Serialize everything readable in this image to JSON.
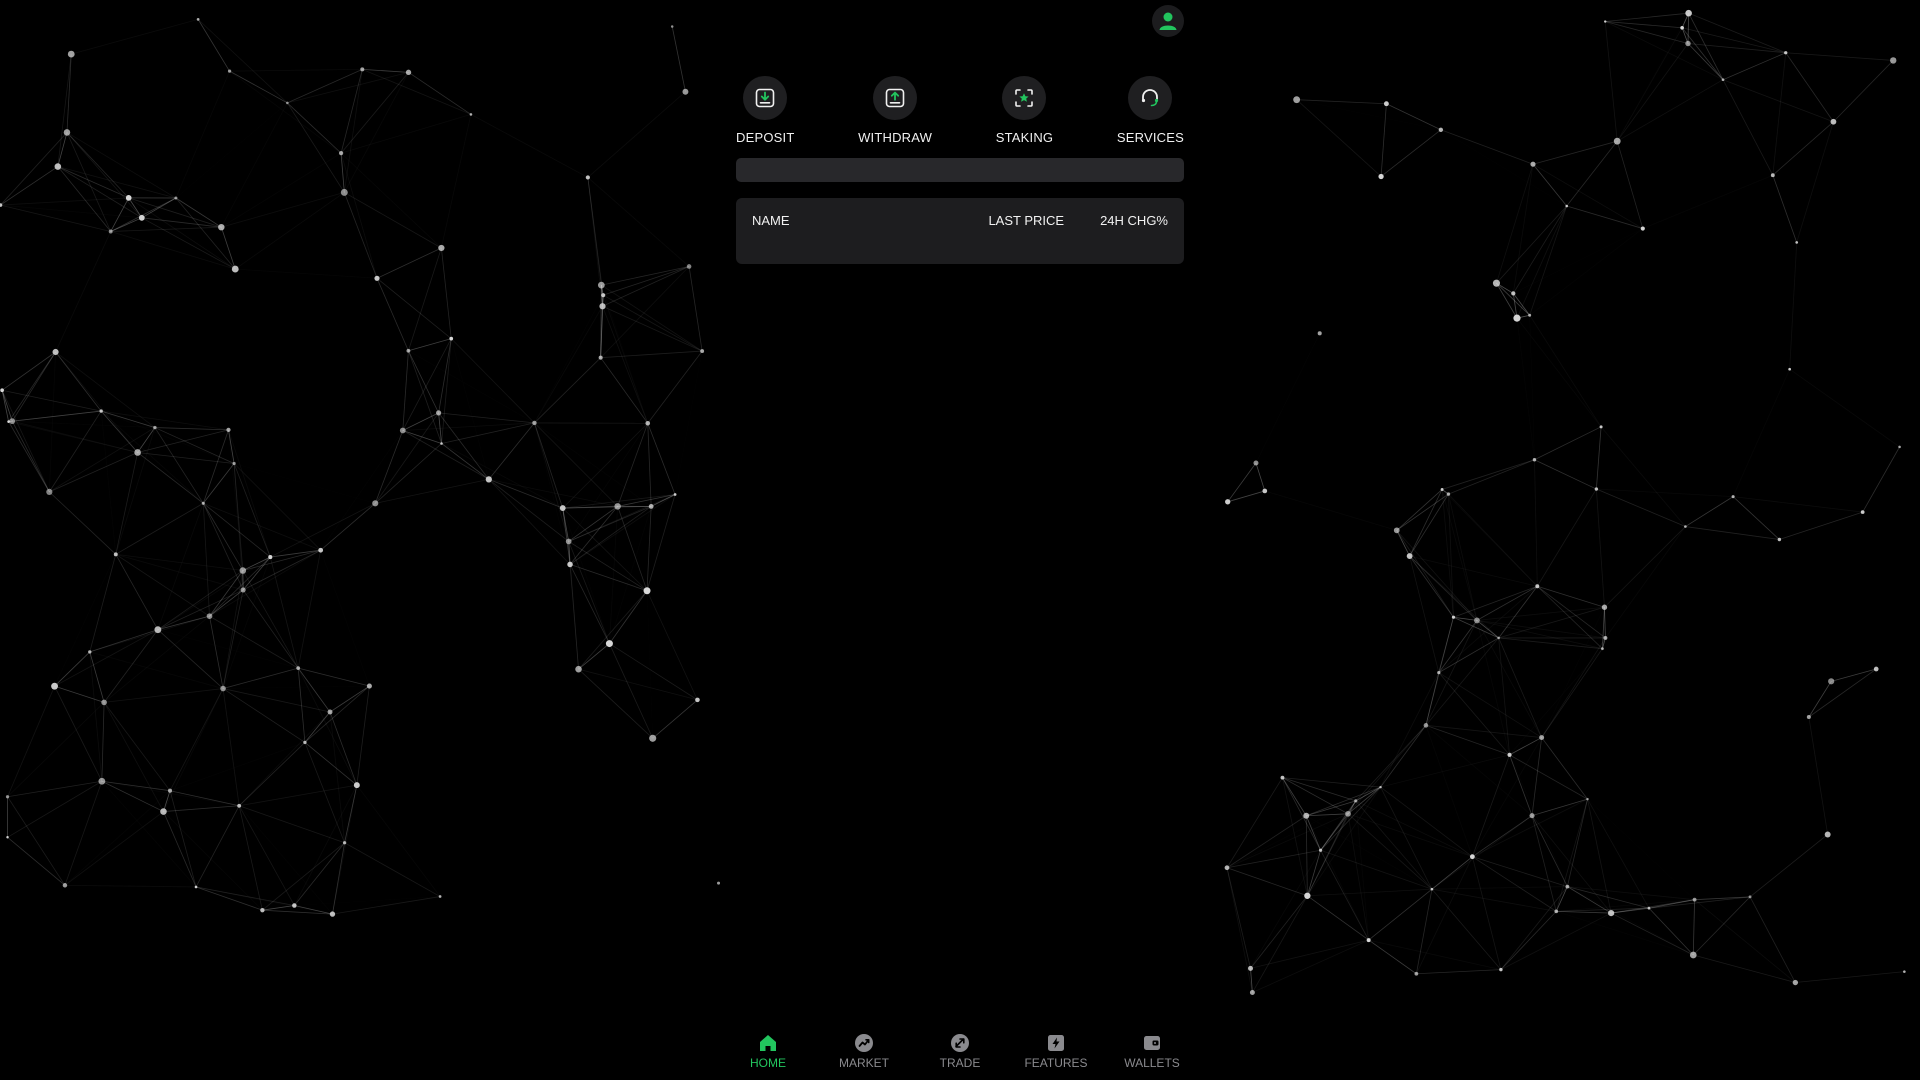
{
  "colors": {
    "accent": "#22c55e",
    "background": "#000000",
    "surface": "#1d1d1f",
    "muted": "#8a8a8e"
  },
  "header": {
    "avatar_icon": "user-icon"
  },
  "actions": [
    {
      "label": "DEPOSIT",
      "icon": "deposit-icon"
    },
    {
      "label": "WITHDRAW",
      "icon": "withdraw-icon"
    },
    {
      "label": "STAKING",
      "icon": "staking-icon"
    },
    {
      "label": "SERVICES",
      "icon": "headset-icon"
    }
  ],
  "search": {
    "placeholder": ""
  },
  "market_table": {
    "columns": {
      "name": "NAME",
      "last_price": "LAST PRICE",
      "change": "24H CHG%"
    },
    "rows": []
  },
  "bottom_nav": [
    {
      "label": "HOME",
      "icon": "home-icon",
      "active": true
    },
    {
      "label": "MARKET",
      "icon": "market-icon",
      "active": false
    },
    {
      "label": "TRADE",
      "icon": "trade-icon",
      "active": false
    },
    {
      "label": "FEATURES",
      "icon": "lightning-icon",
      "active": false
    },
    {
      "label": "WALLETS",
      "icon": "wallet-icon",
      "active": false
    }
  ]
}
